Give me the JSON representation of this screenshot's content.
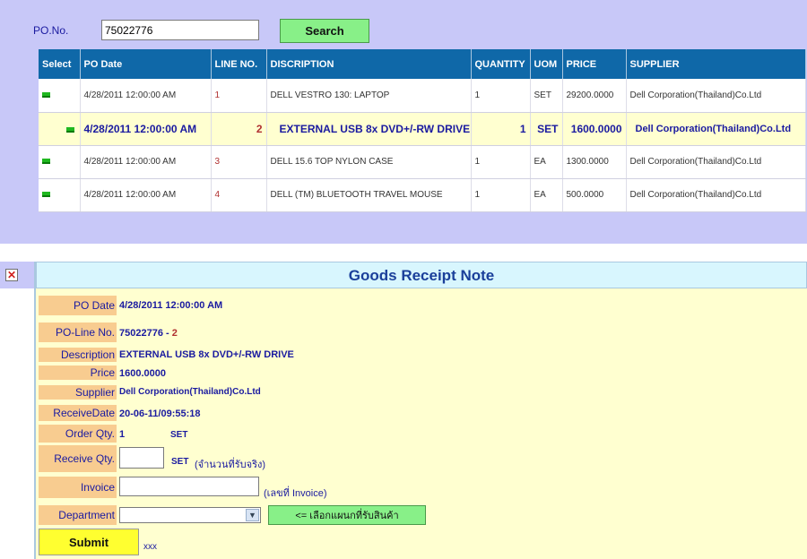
{
  "search": {
    "po_label": "PO.No.",
    "po_value": "75022776",
    "search_label": "Search"
  },
  "table": {
    "headers": [
      "Select",
      "PO Date",
      "LINE NO.",
      "DISCRIPTION",
      "QUANTITY",
      "UOM",
      "PRICE",
      "SUPPLIER"
    ],
    "rows": [
      {
        "po_date": "4/28/2011 12:00:00 AM",
        "line_no": "1",
        "description": "DELL VESTRO 130: LAPTOP",
        "quantity": "1",
        "uom": "SET",
        "price": "29200.0000",
        "supplier": "Dell Corporation(Thailand)Co.Ltd"
      },
      {
        "po_date": "4/28/2011 12:00:00 AM",
        "line_no": "2",
        "description": "EXTERNAL USB 8x DVD+/-RW DRIVE",
        "quantity": "1",
        "uom": "SET",
        "price": "1600.0000",
        "supplier": "Dell Corporation(Thailand)Co.Ltd"
      },
      {
        "po_date": "4/28/2011 12:00:00 AM",
        "line_no": "3",
        "description": "DELL 15.6 TOP NYLON CASE",
        "quantity": "1",
        "uom": "EA",
        "price": "1300.0000",
        "supplier": "Dell Corporation(Thailand)Co.Ltd"
      },
      {
        "po_date": "4/28/2011 12:00:00 AM",
        "line_no": "4",
        "description": "DELL (TM) BLUETOOTH TRAVEL MOUSE",
        "quantity": "1",
        "uom": "EA",
        "price": "500.0000",
        "supplier": "Dell Corporation(Thailand)Co.Ltd"
      }
    ],
    "selected_row": 1
  },
  "grn": {
    "title": "Goods Receipt Note",
    "po_date_label": "PO Date",
    "po_date": "4/28/2011 12:00:00 AM",
    "po_line_label": "PO-Line No.",
    "po_number": "75022776",
    "po_line_sep": "-",
    "po_line": "2",
    "description_label": "Description",
    "description": "EXTERNAL USB 8x DVD+/-RW DRIVE",
    "price_label": "Price",
    "price": "1600.0000",
    "supplier_label": "Supplier",
    "supplier": "Dell Corporation(Thailand)Co.Ltd",
    "receive_date_label": "ReceiveDate",
    "receive_date": "20-06-11/09:55:18",
    "order_qty_label": "Order Qty.",
    "order_qty": "1",
    "order_uom": "SET",
    "receive_qty_label": "Receive Qty.",
    "receive_qty_value": "",
    "receive_uom": "SET",
    "receive_hint": "(จำนวนที่รับจริง)",
    "invoice_label": "Invoice",
    "invoice_value": "",
    "invoice_hint": "(เลขที่ Invoice)",
    "department_label": "Department",
    "department_value": "",
    "department_button": "<= เลือกแผนกที่รับสินค้า",
    "submit_label": "Submit",
    "footer_text": "xxx"
  },
  "colors": {
    "page_bg": "#c8c8f8",
    "header_blue": "#0f68a8",
    "selected_row": "#ffffd0",
    "label_bg": "#f8cc90",
    "button_green": "#88f088",
    "submit_yellow": "#ffff30"
  },
  "icons": [
    "select-row-icon",
    "close-icon",
    "chevron-down-icon"
  ]
}
